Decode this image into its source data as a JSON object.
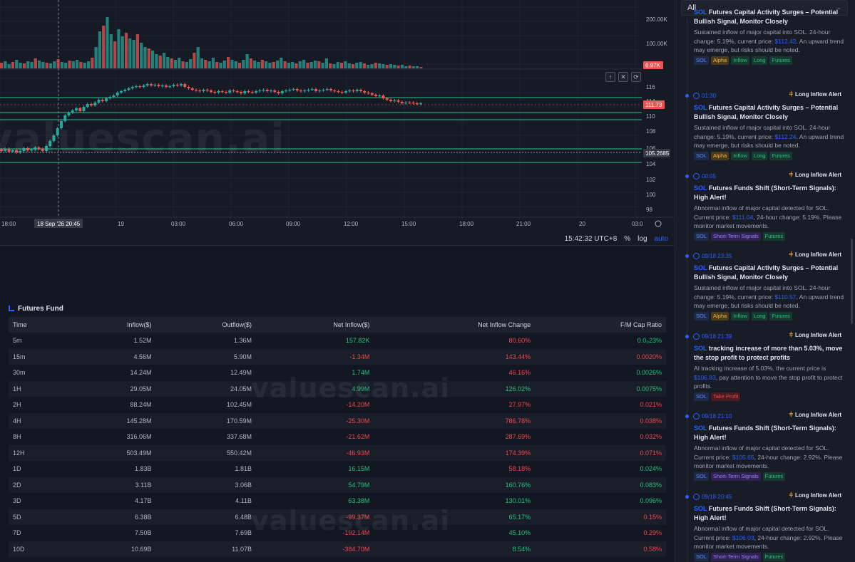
{
  "chart": {
    "watermark": "valuescan.ai",
    "volume_axis": [
      "200.00K",
      "100.00K"
    ],
    "volume_current": "6.97K",
    "price_axis": [
      "116",
      "114",
      "112",
      "110",
      "108",
      "106",
      "104",
      "102",
      "100",
      "98"
    ],
    "price_current": "111.73",
    "price_marker": "105.2685",
    "time_axis": [
      "18:00",
      "19",
      "03:00",
      "06:00",
      "09:00",
      "12:00",
      "15:00",
      "18:00",
      "21:00",
      "20",
      "03:0"
    ],
    "crosshair_time": "18 Sep '26   20:45",
    "status": {
      "time": "15:42:32 UTC+8",
      "percent": "%",
      "log": "log",
      "auto": "auto"
    },
    "controls": [
      "↑",
      "✕",
      "⟳"
    ],
    "colors": {
      "up": "#26a69a",
      "down": "#ef5350",
      "line": "#2ebd85"
    }
  },
  "fund": {
    "title": "Futures Fund",
    "watermark": "valuescan.ai",
    "columns": [
      "Time",
      "Inflow($)",
      "Outflow($)",
      "Net Inflow($)",
      "Net Inflow Change",
      "F/M Cap Ratio"
    ],
    "rows": [
      {
        "time": "5m",
        "inflow": "1.52M",
        "outflow": "1.36M",
        "net": "157.82K",
        "net_pos": true,
        "change": "80.60%",
        "change_pos": false,
        "ratio": "0.0₀23%",
        "ratio_pos": true
      },
      {
        "time": "15m",
        "inflow": "4.56M",
        "outflow": "5.90M",
        "net": "-1.34M",
        "net_pos": false,
        "change": "143.44%",
        "change_pos": false,
        "ratio": "0.0020%",
        "ratio_pos": false
      },
      {
        "time": "30m",
        "inflow": "14.24M",
        "outflow": "12.49M",
        "net": "1.74M",
        "net_pos": true,
        "change": "46.16%",
        "change_pos": false,
        "ratio": "0.0026%",
        "ratio_pos": true
      },
      {
        "time": "1H",
        "inflow": "29.05M",
        "outflow": "24.05M",
        "net": "4.99M",
        "net_pos": true,
        "change": "126.02%",
        "change_pos": true,
        "ratio": "0.0075%",
        "ratio_pos": true
      },
      {
        "time": "2H",
        "inflow": "88.24M",
        "outflow": "102.45M",
        "net": "-14.20M",
        "net_pos": false,
        "change": "27.97%",
        "change_pos": false,
        "ratio": "0.021%",
        "ratio_pos": false
      },
      {
        "time": "4H",
        "inflow": "145.28M",
        "outflow": "170.59M",
        "net": "-25.30M",
        "net_pos": false,
        "change": "786.78%",
        "change_pos": false,
        "ratio": "0.038%",
        "ratio_pos": false
      },
      {
        "time": "8H",
        "inflow": "316.06M",
        "outflow": "337.68M",
        "net": "-21.62M",
        "net_pos": false,
        "change": "287.69%",
        "change_pos": false,
        "ratio": "0.032%",
        "ratio_pos": false
      },
      {
        "time": "12H",
        "inflow": "503.49M",
        "outflow": "550.42M",
        "net": "-46.93M",
        "net_pos": false,
        "change": "174.39%",
        "change_pos": false,
        "ratio": "0.071%",
        "ratio_pos": false
      },
      {
        "time": "1D",
        "inflow": "1.83B",
        "outflow": "1.81B",
        "net": "16.15M",
        "net_pos": true,
        "change": "58.18%",
        "change_pos": false,
        "ratio": "0.024%",
        "ratio_pos": true
      },
      {
        "time": "2D",
        "inflow": "3.11B",
        "outflow": "3.06B",
        "net": "54.79M",
        "net_pos": true,
        "change": "160.76%",
        "change_pos": true,
        "ratio": "0.083%",
        "ratio_pos": true
      },
      {
        "time": "3D",
        "inflow": "4.17B",
        "outflow": "4.11B",
        "net": "63.38M",
        "net_pos": true,
        "change": "130.01%",
        "change_pos": true,
        "ratio": "0.096%",
        "ratio_pos": true
      },
      {
        "time": "5D",
        "inflow": "6.38B",
        "outflow": "6.48B",
        "net": "-99.37M",
        "net_pos": false,
        "change": "65.17%",
        "change_pos": true,
        "ratio": "0.15%",
        "ratio_pos": false
      },
      {
        "time": "7D",
        "inflow": "7.50B",
        "outflow": "7.69B",
        "net": "-192.14M",
        "net_pos": false,
        "change": "45.10%",
        "change_pos": true,
        "ratio": "0.29%",
        "ratio_pos": false
      },
      {
        "time": "10D",
        "inflow": "10.69B",
        "outflow": "11.07B",
        "net": "-384.70M",
        "net_pos": false,
        "change": "8.54%",
        "change_pos": true,
        "ratio": "0.58%",
        "ratio_pos": false
      }
    ]
  },
  "sidebar": {
    "filter_value": "All",
    "alerts": [
      {
        "time": "",
        "kind": "",
        "symbol": "SOL",
        "title": "Futures Capital Activity Surges – Potential Bullish Signal, Monitor Closely",
        "body_pre": "Sustained inflow of major capital into SOL. 24-hour change: 5.19%, current price: ",
        "price": "$112.42",
        "body_post": ". An upward trend may emerge, but risks should be noted.",
        "tags": [
          "SOL",
          "Alpha",
          "Inflow",
          "Long",
          "Futures"
        ]
      },
      {
        "time": "01:30",
        "kind": "Long Inflow Alert",
        "symbol": "SOL",
        "title": "Futures Capital Activity Surges – Potential Bullish Signal, Monitor Closely",
        "body_pre": "Sustained inflow of major capital into SOL. 24-hour change: 5.19%, current price: ",
        "price": "$112.24",
        "body_post": ". An upward trend may emerge, but risks should be noted.",
        "tags": [
          "SOL",
          "Alpha",
          "Inflow",
          "Long",
          "Futures"
        ]
      },
      {
        "time": "00:05",
        "kind": "Long Inflow Alert",
        "symbol": "SOL",
        "title": "Futures Funds Shift (Short-Term Signals): High Alert!",
        "body_pre": "Abnormal inflow of major capital detected for SOL. Current price: ",
        "price": "$111.04",
        "body_post": ", 24-hour change: 5.19%. Please monitor market movements.",
        "tags": [
          "SOL",
          "Short-Term Signals",
          "Futures"
        ]
      },
      {
        "time": "09/18 23:35",
        "kind": "Long Inflow Alert",
        "symbol": "SOL",
        "title": "Futures Capital Activity Surges – Potential Bullish Signal, Monitor Closely",
        "body_pre": "Sustained inflow of major capital into SOL. 24-hour change: 5.19%, current price: ",
        "price": "$110.57",
        "body_post": ". An upward trend may emerge, but risks should be noted.",
        "tags": [
          "SOL",
          "Alpha",
          "Inflow",
          "Long",
          "Futures"
        ]
      },
      {
        "time": "09/18 21:39",
        "kind": "Long Inflow Alert",
        "symbol": "SOL",
        "title": "tracking increase of more than 5.03%, move the stop profit to protect profits",
        "body_pre": "AI tracking increase of 5.03%, the current price is ",
        "price": "$106.83",
        "body_post": ", pay attention to move the stop profit to protect profits.",
        "tags": [
          "SOL",
          "Take Profit"
        ]
      },
      {
        "time": "09/18 21:10",
        "kind": "Long Inflow Alert",
        "symbol": "SOL",
        "title": "Futures Funds Shift (Short-Term Signals): High Alert!",
        "body_pre": "Abnormal inflow of major capital detected for SOL. Current price: ",
        "price": "$105.65",
        "body_post": ", 24-hour change: 2.92%. Please monitor market movements.",
        "tags": [
          "SOL",
          "Short-Term Signals",
          "Futures"
        ]
      },
      {
        "time": "09/18 20:45",
        "kind": "Long Inflow Alert",
        "symbol": "SOL",
        "title": "Futures Funds Shift (Short-Term Signals): High Alert!",
        "body_pre": "Abnormal inflow of major capital detected for SOL. Current price: ",
        "price": "$106.03",
        "body_post": ", 24-hour change: 2.92%. Please monitor market movements.",
        "tags": [
          "SOL",
          "Short-Term Signals",
          "Futures"
        ]
      }
    ]
  }
}
